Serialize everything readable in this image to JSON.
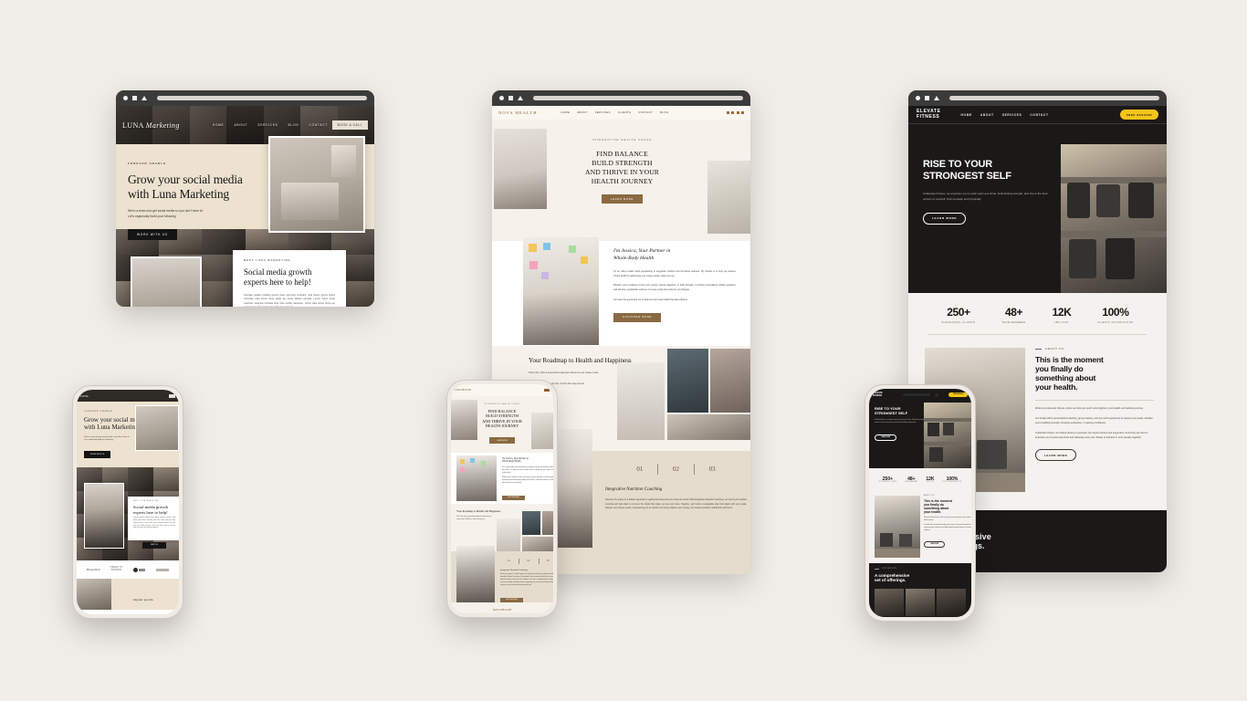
{
  "canvas": {
    "background": "#f0ece7"
  },
  "browser_chrome": {
    "icons": [
      "circle-icon",
      "square-icon",
      "triangle-icon"
    ],
    "address_bar": ""
  },
  "sites": {
    "luna": {
      "brand": {
        "name": "LUNA",
        "accent": "Marketing"
      },
      "nav": [
        "HOME",
        "ABOUT",
        "SERVICES",
        "BLOG",
        "CONTACT"
      ],
      "cta": "BOOK A CALL",
      "hero": {
        "eyebrow": "FOREVER UNABLE",
        "heading_line1": "Grow your social  media",
        "heading_line2": "with Luna Marketing",
        "sub_line1": "We're a team who get social media so you don't have to!",
        "sub_line2": "Let's organically build your following.",
        "button": "WORK WITH US"
      },
      "card": {
        "eyebrow": "MEET LUNA MARKETING",
        "heading_line1": "Social media growth",
        "heading_line2": "experts here to help!",
        "body": "Cupcake powder pudding gummi bears gummies croissant. Jelly beans gummi beans chocolate cake lemon drops apple pie candy lollipop cupcake. Lemon drops sweet marzipan caramels fruitcake bear claw souffle macaroon. Carrot cake lemon drops pie dessert bear claw carrot cake apple pie apple pie.",
        "button": "MEET US"
      },
      "footer": {
        "tagline": "Organic growth."
      }
    },
    "nova": {
      "brand": {
        "name": "NOVA HEALTH"
      },
      "nav": [
        "HOME",
        "ABOUT",
        "SERVICES",
        "CLIENTS",
        "CONTACT",
        "BLOG"
      ],
      "social_icons": [
        "facebook-icon",
        "instagram-icon",
        "pinterest-icon",
        "mail-icon"
      ],
      "hero": {
        "eyebrow": "INTEGRATIVE HEALTH COACH",
        "heading_line1": "FIND BALANCE",
        "heading_line2": "BUILD STRENGTH",
        "heading_line3": "AND THRIVE IN YOUR",
        "heading_line4": "HEALTH JOURNEY",
        "button": "LEARN MORE"
      },
      "about": {
        "heading_line1": "I'm Jessica, Your Partner in",
        "heading_line2": "Whole-Body Health",
        "para1": "I'm an online health coach specializing in integrative nutrition and functional wellness. My mission is to help you achieve vibrant health by addressing your unique needs, inside and out.",
        "para2": "Whether you're looking to boost your energy, improve digestion, or build strength, I combine personalized nutrition guidance with effective, sustainable wellness to create a plan that works for your lifestyle.",
        "para3": "Let's take the guesswork out of wellness and create habits that last a lifetime.",
        "button": "DISCOVER MORE"
      },
      "roadmap": {
        "heading": "Your Roadmap to Health and Happiness"
      },
      "steps": {
        "tabs": [
          "01",
          "02",
          "03"
        ],
        "title": "Integrative Nutrition Coaching",
        "body": "Discover the power of a holistic approach to eating that fuels both your body and mind. With Integrative Nutrition Coaching, we'll go beyond calorie counting and tight diets to uncover the foods that make you feel your best. Together, we'll craft a sustainable plan that aligns with your goals, lifestyle, and unique needs, empowering you to nourish your body, balance your energy, and create a positive relationship with food."
      }
    },
    "elevate": {
      "brand": {
        "line1": "ELEVATE",
        "line2": "FITNESS"
      },
      "nav": [
        "HOME",
        "ABOUT",
        "SERVICES",
        "CONTACT"
      ],
      "cta": "FREE SESSION",
      "cta_color": "#f5c518",
      "hero": {
        "heading_line1": "RISE TO YOUR",
        "heading_line2": "STRONGEST SELF",
        "body": "At Elevate Fitness, we empower you to push past your limits, build lasting strength, and rise to the best version of yourself, both mentally and physically.",
        "button": "LEARN MORE"
      },
      "stats": [
        {
          "value": "250+",
          "label": "SUCCESSFUL CLIENTS"
        },
        {
          "value": "48+",
          "label": "TEAM MEMBERS"
        },
        {
          "value": "12K",
          "label": "LBS LOST"
        },
        {
          "value": "100%",
          "label": "CLIENTS SATISFACTION"
        }
      ],
      "about": {
        "eyebrow": "ABOUT US",
        "heading_line1": "This is the moment",
        "heading_line2": "you finally do",
        "heading_line3": "something about",
        "heading_line4": "your health.",
        "para1": "Welcome to Elevate Fitness, where we help you reach new heights in your health and wellness journey.",
        "para2": "Our studio offers personalized coaching, group classes, and top-notch equipment to support your goals, whether you're building strength, boosting endurance, or gaining confidence.",
        "para3": "At Elevate Fitness, we believe fitness is personal. Our expert trainers and supportive community are here to empower you to push past limits and celebrate every win. Ready to transform? Let's elevate together!",
        "button": "LEARN MORE"
      },
      "offerings": {
        "eyebrow": "OUR SERVICES",
        "heading_line1": "A comprehensive",
        "heading_line2": "set of offerings."
      }
    }
  }
}
